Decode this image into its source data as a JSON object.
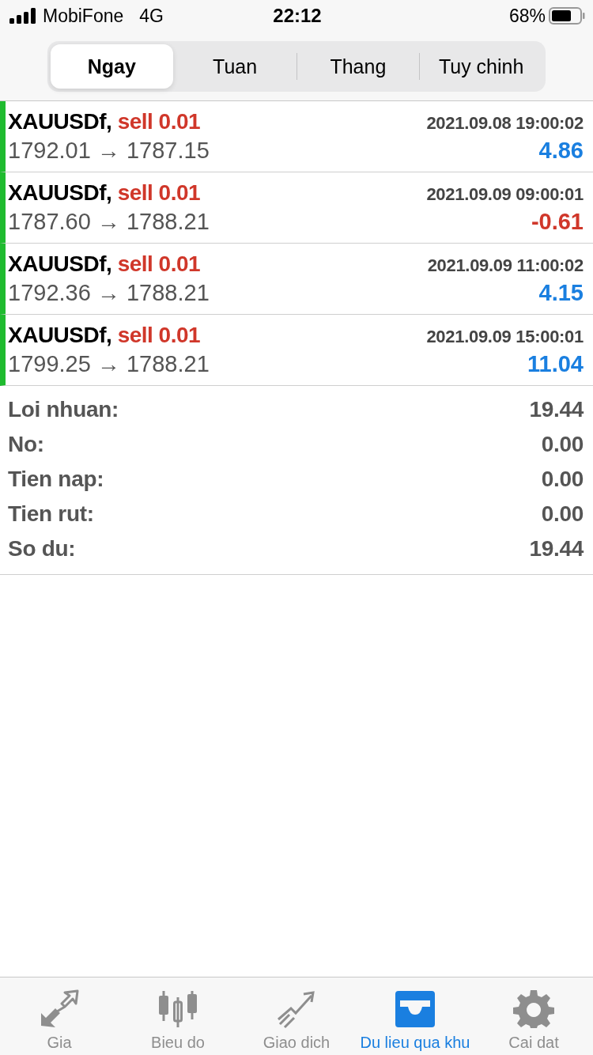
{
  "status_bar": {
    "carrier": "MobiFone",
    "network": "4G",
    "time": "22:12",
    "battery": "68%"
  },
  "period_tabs": [
    {
      "label": "Ngay",
      "selected": true
    },
    {
      "label": "Tuan",
      "selected": false
    },
    {
      "label": "Thang",
      "selected": false
    },
    {
      "label": "Tuy chinh",
      "selected": false
    }
  ],
  "trades": [
    {
      "symbol": "XAUUSDf,",
      "order": "sell 0.01",
      "time": "2021.09.08 19:00:02",
      "prices": "1792.01 → 1787.15",
      "profit": "4.86",
      "color": "#1a7fe0"
    },
    {
      "symbol": "XAUUSDf,",
      "order": "sell 0.01",
      "time": "2021.09.09 09:00:01",
      "prices": "1787.60 → 1788.21",
      "profit": "-0.61",
      "color": "#d0372a"
    },
    {
      "symbol": "XAUUSDf,",
      "order": "sell 0.01",
      "time": "2021.09.09 11:00:02",
      "prices": "1792.36 → 1788.21",
      "profit": "4.15",
      "color": "#1a7fe0"
    },
    {
      "symbol": "XAUUSDf,",
      "order": "sell 0.01",
      "time": "2021.09.09 15:00:01",
      "prices": "1799.25 → 1788.21",
      "profit": "11.04",
      "color": "#1a7fe0"
    }
  ],
  "summary": [
    {
      "label": "Loi nhuan:",
      "value": "19.44"
    },
    {
      "label": "No:",
      "value": "0.00"
    },
    {
      "label": "Tien nap:",
      "value": "0.00"
    },
    {
      "label": "Tien rut:",
      "value": "0.00"
    },
    {
      "label": "So du:",
      "value": "19.44"
    }
  ],
  "tab_bar": [
    {
      "label": "Gia",
      "kind": "quotes",
      "selected": false
    },
    {
      "label": "Bieu do",
      "kind": "chart",
      "selected": false
    },
    {
      "label": "Giao dich",
      "kind": "trade",
      "selected": false
    },
    {
      "label": "Du lieu qua khu",
      "kind": "history",
      "selected": true
    },
    {
      "label": "Cai dat",
      "kind": "settings",
      "selected": false
    }
  ]
}
